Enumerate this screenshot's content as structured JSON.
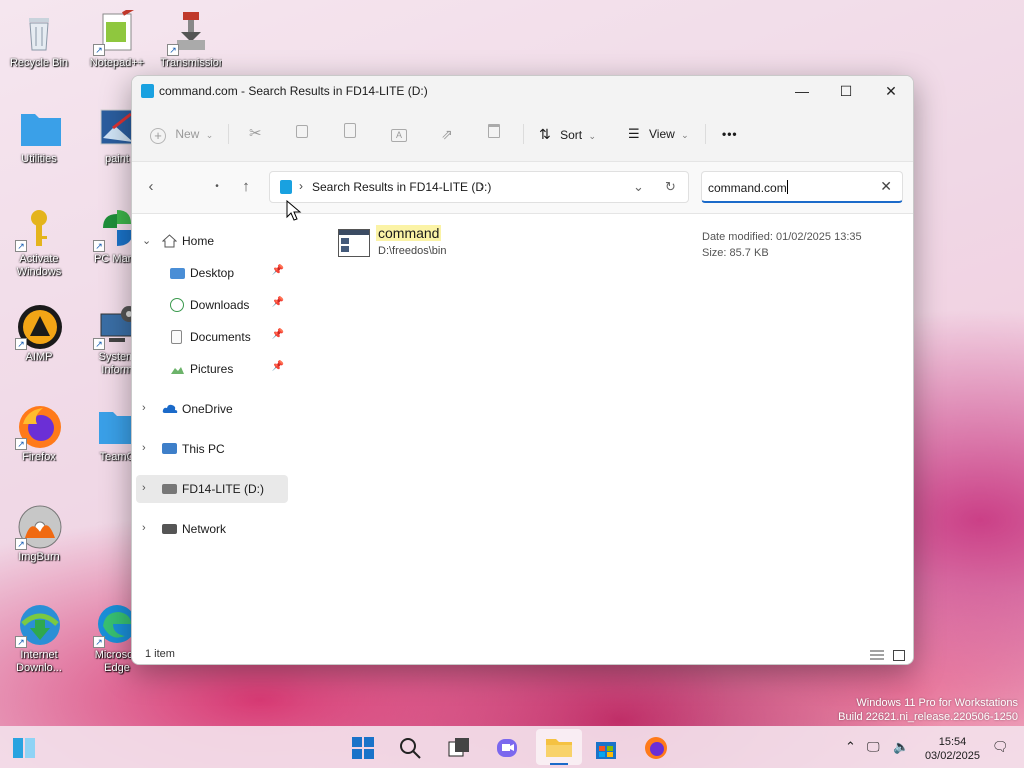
{
  "desktop": {
    "icons": [
      {
        "label": "Recycle Bin",
        "icon": "recycle-bin-icon",
        "shortcut": false
      },
      {
        "label": "Notepad++",
        "icon": "notepad-plus-plus-icon",
        "shortcut": true
      },
      {
        "label": "Transmission",
        "icon": "transmission-icon",
        "shortcut": true
      },
      {
        "label": "Utilities",
        "icon": "folder-icon",
        "shortcut": false
      },
      {
        "label": "paint",
        "icon": "paint-icon",
        "shortcut": false
      },
      {
        "label": "Activate Windows",
        "icon": "key-icon",
        "shortcut": true
      },
      {
        "label": "PC Mana",
        "icon": "pc-manager-icon",
        "shortcut": true
      },
      {
        "label": "AIMP",
        "icon": "aimp-icon",
        "shortcut": true
      },
      {
        "label": "System Inform",
        "icon": "system-information-icon",
        "shortcut": true
      },
      {
        "label": "Firefox",
        "icon": "firefox-icon",
        "shortcut": true
      },
      {
        "label": "TeamC",
        "icon": "folder-icon",
        "shortcut": false
      },
      {
        "label": "ImgBurn",
        "icon": "imgburn-icon",
        "shortcut": true
      },
      {
        "label": "Internet Downlo...",
        "icon": "internet-download-manager-icon",
        "shortcut": true
      },
      {
        "label": "Microsoft Edge",
        "icon": "edge-icon",
        "shortcut": true
      }
    ]
  },
  "window": {
    "title": "command.com - Search Results in FD14-LITE (D:)",
    "controls": {
      "minimize": "—",
      "maximize": "☐",
      "close": "✕"
    }
  },
  "toolbar": {
    "new_label": "New",
    "sort_label": "Sort",
    "view_label": "View",
    "more_label": "•••"
  },
  "navigation": {
    "breadcrumb": "Search Results in FD14-LITE (D:)",
    "search_value": "command.com"
  },
  "sidebar": {
    "home": "Home",
    "quick_access": [
      {
        "label": "Desktop",
        "icon": "desktop-icon"
      },
      {
        "label": "Downloads",
        "icon": "downloads-icon"
      },
      {
        "label": "Documents",
        "icon": "documents-icon"
      },
      {
        "label": "Pictures",
        "icon": "pictures-icon"
      }
    ],
    "onedrive": "OneDrive",
    "this_pc": "This PC",
    "drive": "FD14-LITE (D:)",
    "network": "Network"
  },
  "results": [
    {
      "name": "command",
      "path": "D:\\freedos\\bin",
      "date_modified": "Date modified: 01/02/2025 13:35",
      "size": "Size: 85.7 KB"
    }
  ],
  "status": {
    "item_count": "1 item"
  },
  "watermark": {
    "line1": "Windows 11 Pro for Workstations",
    "line2": "Build 22621.ni_release.220506-1250"
  },
  "taskbar": {
    "time": "15:54",
    "date": "03/02/2025"
  },
  "colors": {
    "accent": "#1b6ac9",
    "folder": "#3aa0e8",
    "highlight": "#fbf3a6"
  }
}
